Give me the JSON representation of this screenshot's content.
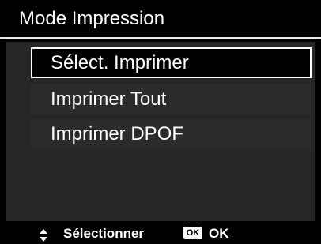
{
  "header": {
    "title": "Mode Impression"
  },
  "menu": {
    "items": [
      {
        "label": "Sélect. Imprimer",
        "selected": true
      },
      {
        "label": "Imprimer Tout",
        "selected": false
      },
      {
        "label": "Imprimer DPOF",
        "selected": false
      }
    ]
  },
  "footer": {
    "navigate_icon": "up-down-arrows-icon",
    "navigate_label": "Sélectionner",
    "ok_icon_text": "OK",
    "ok_label": "OK"
  },
  "colors": {
    "background": "#000000",
    "panel": "#262626",
    "item": "#2b2b2b",
    "highlight_border": "#ffffff",
    "text": "#ffffff"
  }
}
